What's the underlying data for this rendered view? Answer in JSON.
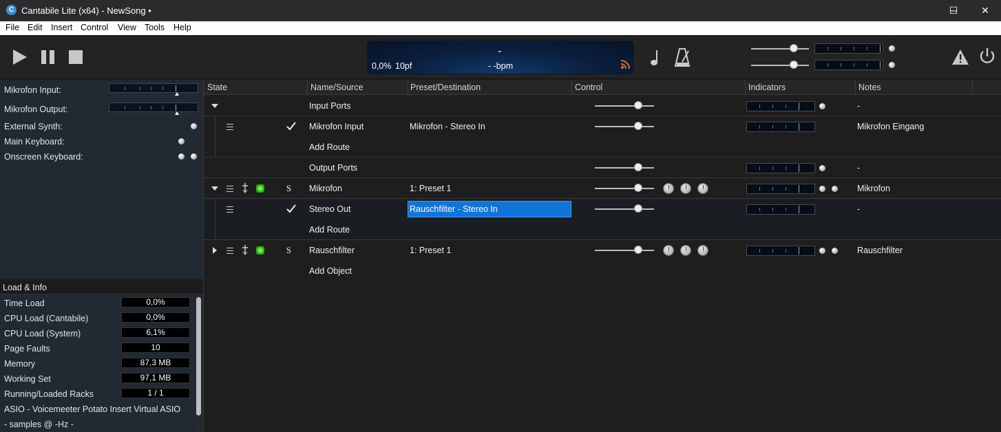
{
  "titlebar": {
    "app_title": "Cantabile Lite (x64) - NewSong •",
    "minimize": "─",
    "maximize": "☐",
    "close": "✕"
  },
  "menu": [
    "File",
    "Edit",
    "Insert",
    "Control",
    "View",
    "Tools",
    "Help"
  ],
  "transport": {
    "display_main": "-",
    "display_load": "0,0%",
    "display_pf": "10pf",
    "display_bpm": "- -bpm"
  },
  "inputs_panel": [
    {
      "label": "Mikrofon Input:",
      "level": 0.74
    },
    {
      "label": "Mikrofon Output:",
      "level": 0.74
    },
    {
      "label": "External Synth:"
    },
    {
      "label": "Main Keyboard:"
    },
    {
      "label": "Onscreen Keyboard:"
    }
  ],
  "load_info": {
    "header": "Load & Info",
    "rows": [
      {
        "label": "Time Load",
        "value": "0,0%"
      },
      {
        "label": "CPU Load (Cantabile)",
        "value": "0,0%"
      },
      {
        "label": "CPU Load (System)",
        "value": "6,1%"
      },
      {
        "label": "Page Faults",
        "value": "10"
      },
      {
        "label": "Memory",
        "value": "87,3 MB"
      },
      {
        "label": "Working Set",
        "value": "97,1 MB"
      },
      {
        "label": "Running/Loaded Racks",
        "value": "1 / 1"
      }
    ],
    "asio": "ASIO - Voicemeeter Potato Insert Virtual ASIO",
    "samples": "- samples @ -Hz -"
  },
  "columns": {
    "state": "State",
    "name": "Name/Source",
    "preset": "Preset/Destination",
    "control": "Control",
    "indicators": "Indicators",
    "notes": "Notes"
  },
  "rows": [
    {
      "name": "Input Ports",
      "preset": "",
      "notes": "-"
    },
    {
      "name": "Mikrofon Input",
      "preset": "Mikrofon - Stereo In",
      "notes": "Mikrofon Eingang"
    },
    {
      "name": "Add Route",
      "preset": "",
      "notes": ""
    },
    {
      "name": "Output Ports",
      "preset": "",
      "notes": "-"
    },
    {
      "name": "Mikrofon",
      "preset": "1: Preset 1",
      "notes": "Mikrofon",
      "solo": "S"
    },
    {
      "name": "Stereo Out",
      "preset": "Rauschfilter - Stereo In",
      "notes": "-"
    },
    {
      "name": "Add Route",
      "preset": "",
      "notes": ""
    },
    {
      "name": "Rauschfilter",
      "preset": "1: Preset 1",
      "notes": "Rauschfilter",
      "solo": "S"
    },
    {
      "name": "Add Object",
      "preset": "",
      "notes": ""
    }
  ],
  "colors": {
    "accent": "#1a7fe8",
    "selected_preset_bg": "#1274d9",
    "panel_bg": "#212933",
    "main_bg": "#1e1e1e",
    "led_green": "#2ec716"
  },
  "icons": [
    "play-icon",
    "pause-icon",
    "stop-icon",
    "rss-icon",
    "note-icon",
    "metronome-icon",
    "warning-icon",
    "power-icon",
    "check-icon",
    "hamburger-icon",
    "pin-icon",
    "expand-icon",
    "collapse-icon"
  ]
}
